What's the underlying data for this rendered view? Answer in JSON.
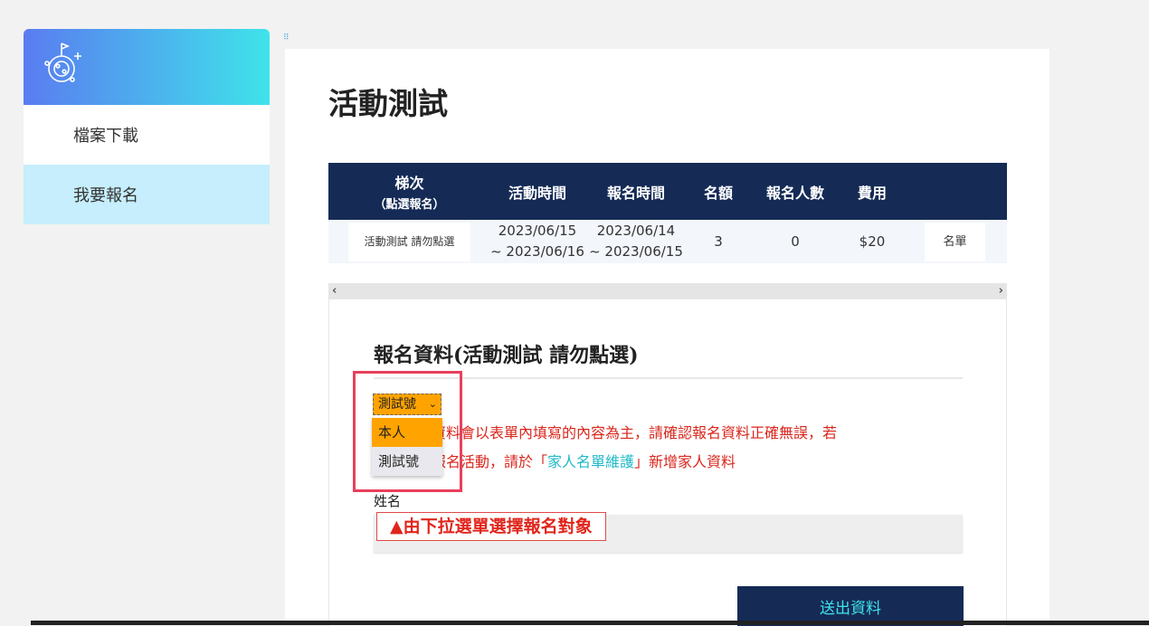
{
  "sidebar": {
    "logo_icon": "planet-compass-icon",
    "items": [
      {
        "label": "檔案下載"
      },
      {
        "label": "我要報名"
      }
    ]
  },
  "page": {
    "title": "活動測試"
  },
  "table": {
    "headers": {
      "session": "梯次",
      "session_sub": "（點選報名）",
      "activity_time": "活動時間",
      "signup_time": "報名時間",
      "quota": "名額",
      "registered": "報名人數",
      "fee": "費用"
    },
    "rows": [
      {
        "session": "活動測試 請勿點選",
        "activity_start": "2023/06/15",
        "activity_end": "~ 2023/06/16",
        "signup_start": "2023/06/14",
        "signup_end": "~ 2023/06/15",
        "quota": "3",
        "registered": "0",
        "fee": "$20",
        "list_button": "名單"
      }
    ]
  },
  "scrollbar": {
    "left": "‹",
    "right": "›"
  },
  "form": {
    "title": "報名資料(活動測試 請勿點選)",
    "select_value": "測試號",
    "options": [
      "本人",
      "測試號"
    ],
    "notice_part1": "最終報名資料會以表單內填寫的內容為主，請確認報名資料正確無誤，若",
    "notice_part2": "要為家人報名活動，請於「",
    "notice_link": "家人名單維護",
    "notice_part3": "」新增家人資料",
    "name_label": "姓名",
    "hint": "▲由下拉選單選擇報名對象",
    "submit": "送出資料"
  },
  "colors": {
    "nav_dark": "#152b56",
    "accent_orange": "#ffa300",
    "notice_red": "#d9261c",
    "link_cyan": "#20b9c8",
    "highlight_pink": "#e8405c"
  }
}
